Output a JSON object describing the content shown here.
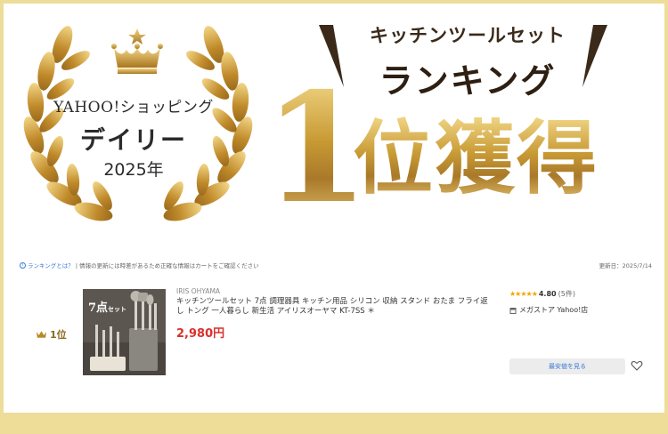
{
  "banner": {
    "badge_line1": "YAHOO!ショッピング",
    "badge_line2": "デイリー",
    "badge_line3": "2025年",
    "category_title": "キッチンツールセット",
    "ranking_title": "ランキング",
    "big_number": "1",
    "award_text": "位獲得",
    "gold_color": "#c89a34",
    "frame_color": "#eedd99"
  },
  "info_bar": {
    "info_icon": "info-circle-icon",
    "ranking_link": "ランキングとは？",
    "notice": "| 情報の更新には時差があるため正確な情報はカートをご確認ください",
    "updated": "更新日：2025/7/14"
  },
  "product": {
    "rank_label": "1位",
    "rank_icon": "crown-icon",
    "image_tag": "7点",
    "image_tag_suffix": "セット",
    "brand": "IRIS OHYAMA",
    "title": "キッチンツールセット 7点 調理器具 キッチン用品 シリコン 収納 スタンド おたま フライ返し トング 一人暮らし 新生活 アイリスオーヤマ KT-7SS ＊",
    "price": "2,980円",
    "price_color": "#d9302c",
    "stars": "★★★★★",
    "rating_value": "4.80",
    "rating_count": "(5件)",
    "store_icon": "store-icon",
    "store_name": "メガストア Yahoo!店",
    "cheapest_button": "最安値を見る",
    "favorite_icon": "heart-icon"
  }
}
